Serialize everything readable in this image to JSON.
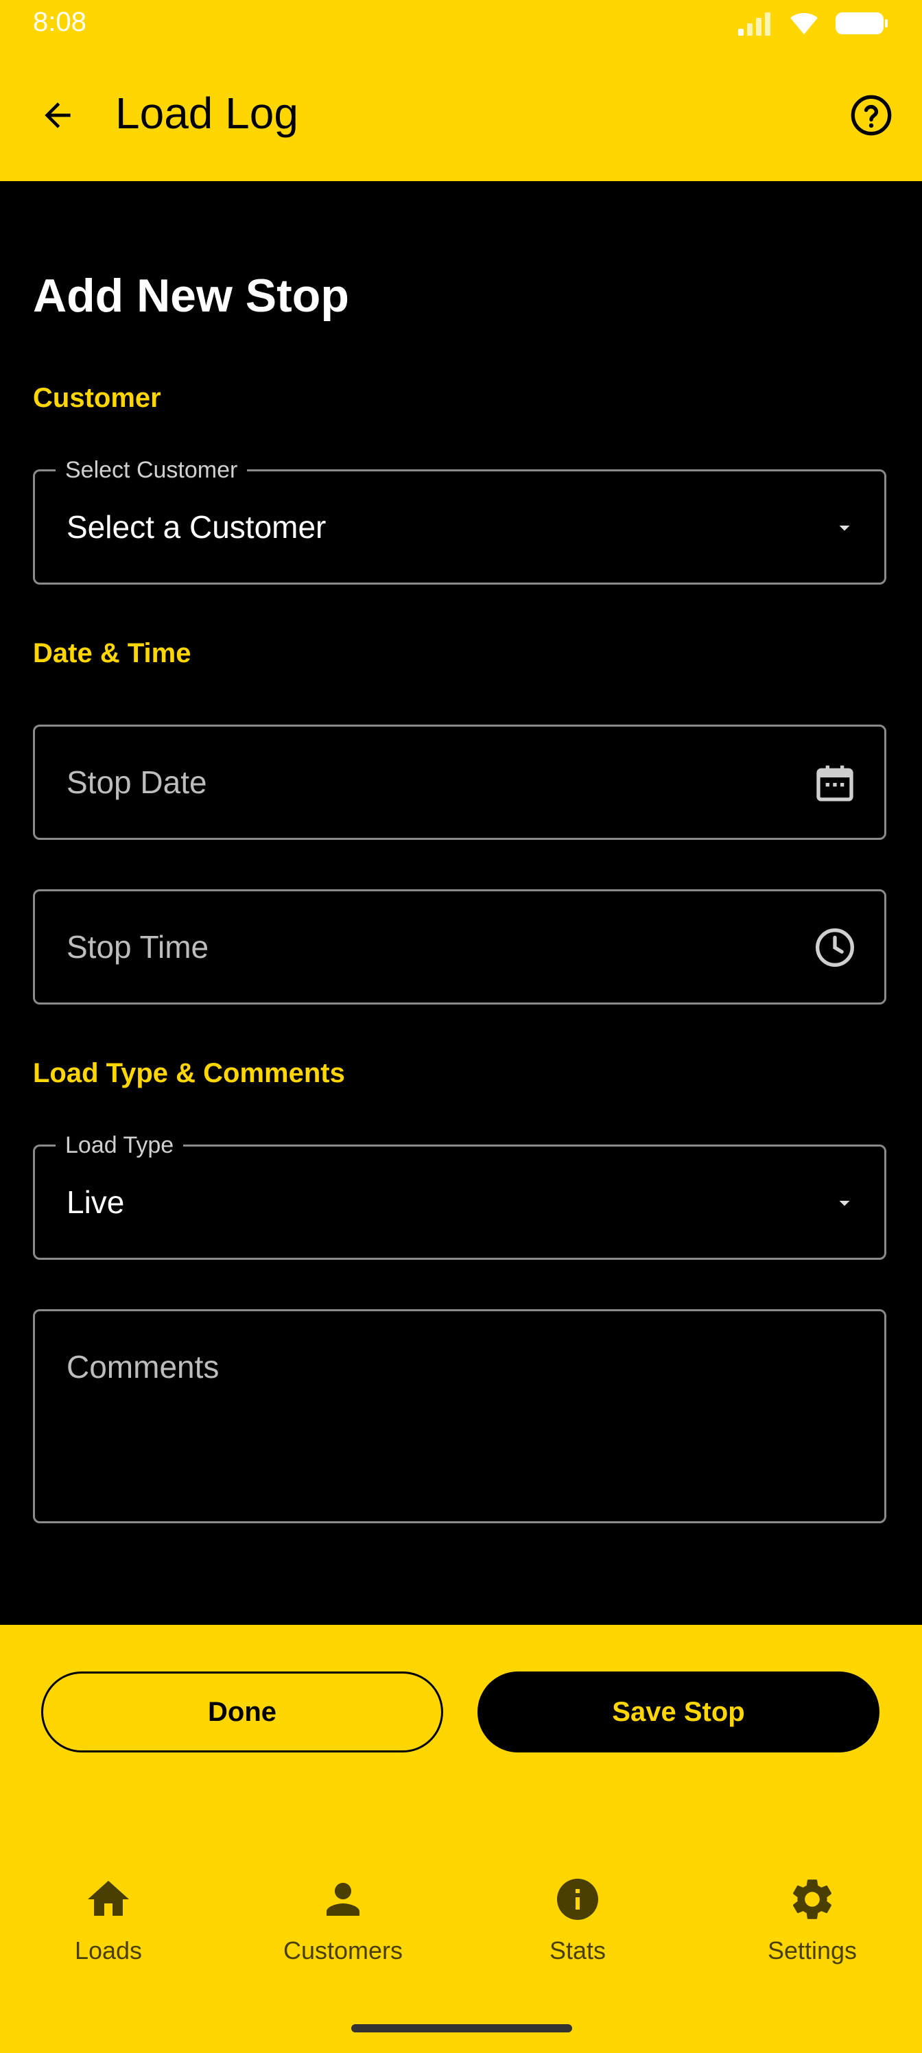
{
  "status_bar": {
    "time": "8:08"
  },
  "app_bar": {
    "title": "Load Log"
  },
  "page": {
    "title": "Add New Stop"
  },
  "sections": {
    "customer": "Customer",
    "date_time": "Date & Time",
    "load_type_comments": "Load Type & Comments"
  },
  "fields": {
    "customer": {
      "label": "Select Customer",
      "value": "Select a Customer"
    },
    "stop_date": {
      "placeholder": "Stop Date"
    },
    "stop_time": {
      "placeholder": "Stop Time"
    },
    "load_type": {
      "label": "Load Type",
      "value": "Live"
    },
    "comments": {
      "placeholder": "Comments"
    }
  },
  "actions": {
    "done": "Done",
    "save": "Save Stop"
  },
  "nav": {
    "items": [
      {
        "label": "Loads",
        "icon": "home-icon"
      },
      {
        "label": "Customers",
        "icon": "person-icon"
      },
      {
        "label": "Stats",
        "icon": "info-icon"
      },
      {
        "label": "Settings",
        "icon": "gear-icon"
      }
    ]
  },
  "colors": {
    "accent": "#FFD600",
    "background": "#000000",
    "border": "#8A8A8A",
    "nav_icon": "#4A3F00"
  }
}
